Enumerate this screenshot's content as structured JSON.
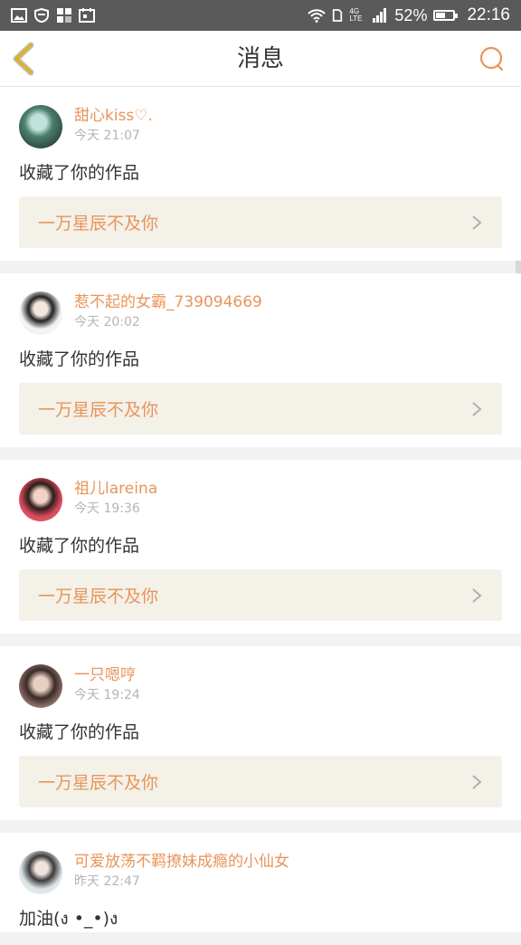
{
  "status_bar": {
    "battery": "52%",
    "time": "22:16",
    "network": "4G LTE",
    "icons": [
      "image-icon",
      "shield-icon",
      "apps-icon",
      "calendar-icon",
      "wifi-icon",
      "sim-icon",
      "signal-icon",
      "battery-icon"
    ]
  },
  "header": {
    "title": "消息",
    "back_icon": "back-chevron-icon",
    "chat_icon": "chat-bubble-icon"
  },
  "colors": {
    "accent": "#e8955a",
    "back_icon": "#d9b233",
    "link_bg": "#f3f1e8"
  },
  "messages": [
    {
      "username": "甜心kiss♡.",
      "time": "今天 21:07",
      "action": "收藏了你的作品",
      "work_title": "一万星辰不及你"
    },
    {
      "username": "惹不起的女霸_739094669",
      "time": "今天 20:02",
      "action": "收藏了你的作品",
      "work_title": "一万星辰不及你"
    },
    {
      "username": "祖儿lareina",
      "time": "今天 19:36",
      "action": "收藏了你的作品",
      "work_title": "一万星辰不及你"
    },
    {
      "username": "一只嗯哼",
      "time": "今天 19:24",
      "action": "收藏了你的作品",
      "work_title": "一万星辰不及你"
    },
    {
      "username": "可爱放荡不羁撩妹成瘾的小仙女",
      "time": "昨天 22:47",
      "action": "加油(ง •_•)ง"
    }
  ]
}
